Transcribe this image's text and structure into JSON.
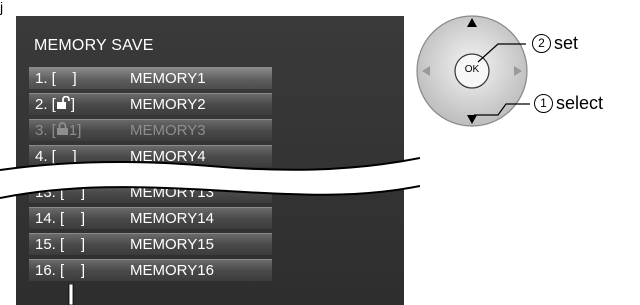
{
  "corner_mark": "j",
  "menu": {
    "title": "MEMORY SAVE",
    "rows": [
      {
        "num": "1. [    ]",
        "name": "MEMORY1",
        "selected": true,
        "disabled": false,
        "icon": ""
      },
      {
        "num": "2. [",
        "num_after": "]",
        "name": "MEMORY2",
        "selected": false,
        "disabled": false,
        "icon": "unlock-icon"
      },
      {
        "num": "3. [",
        "num_after": "1]",
        "name": "MEMORY3",
        "selected": false,
        "disabled": true,
        "icon": "lock-icon"
      },
      {
        "num": "4. [    ]",
        "name": "MEMORY4",
        "selected": false,
        "disabled": false,
        "icon": ""
      },
      {
        "num": "13. [    ]",
        "name": "MEMORY13",
        "selected": false,
        "disabled": false,
        "icon": ""
      },
      {
        "num": "14. [    ]",
        "name": "MEMORY14",
        "selected": false,
        "disabled": false,
        "icon": ""
      },
      {
        "num": "15. [    ]",
        "name": "MEMORY15",
        "selected": false,
        "disabled": false,
        "icon": ""
      },
      {
        "num": "16. [    ]",
        "name": "MEMORY16",
        "selected": false,
        "disabled": false,
        "icon": ""
      }
    ]
  },
  "remote": {
    "ok_label": "OK",
    "set_label": "set",
    "set_number": "2",
    "select_label": "select",
    "select_number": "1"
  },
  "colors": {
    "panel": "#333333",
    "row_text": "#ffffff",
    "disabled_text": "#8e8e8e"
  }
}
